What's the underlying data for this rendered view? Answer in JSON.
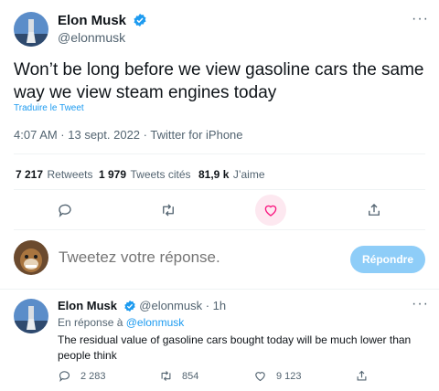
{
  "tweet": {
    "author_name": "Elon Musk",
    "author_handle": "@elonmusk",
    "text": "Won’t be long before we view gasoline cars the same way we view steam engines today",
    "translate_label": "Traduire le Tweet",
    "timestamp": "4:07 AM · 13 sept. 2022 · Twitter for iPhone",
    "stats": {
      "retweets_count": "7 217",
      "retweets_label": "Retweets",
      "quotes_count": "1 979",
      "quotes_label": "Tweets cités",
      "likes_count": "81,9 k",
      "likes_label": "J’aime"
    },
    "actions": [
      "reply-icon",
      "retweet-icon",
      "like-icon",
      "share-icon"
    ]
  },
  "compose": {
    "placeholder": "Tweetez votre réponse.",
    "reply_button": "Répondre"
  },
  "reply": {
    "author_name": "Elon Musk",
    "author_handle": "@elonmusk",
    "time": "· 1h",
    "in_reply_prefix": "En réponse à",
    "in_reply_handle": "@elonmusk",
    "text": "The residual value of gasoline cars bought today will be much lower than people think",
    "replies": "2 283",
    "retweets": "854",
    "likes": "9 123"
  },
  "colors": {
    "accent": "#1d9bf0",
    "like_hover": "#f91880",
    "reply_button_disabled": "#8ecdf8",
    "muted_text": "#536471"
  }
}
